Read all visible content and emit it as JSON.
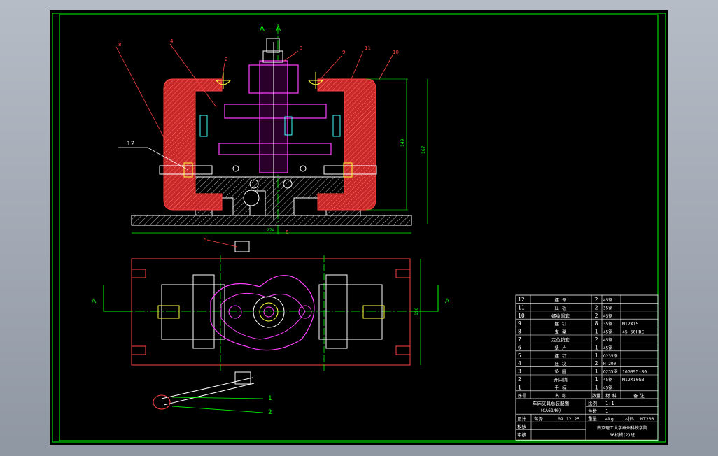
{
  "drawing": {
    "section_label": "A — A",
    "view_marker": "A",
    "part_callouts": [
      "8",
      "4",
      "2",
      "3",
      "9",
      "11",
      "10",
      "12",
      "6",
      "5",
      "1",
      "2"
    ],
    "dimensions": {
      "overall_width": "274",
      "height_inner": "149",
      "height_outer": "167",
      "plan_height": "196"
    }
  },
  "bom": {
    "rows": [
      {
        "no": "12",
        "name": "螺 母",
        "qty": "2",
        "material": "45钢",
        "note": ""
      },
      {
        "no": "11",
        "name": "压 板",
        "qty": "2",
        "material": "35钢",
        "note": ""
      },
      {
        "no": "10",
        "name": "螺纹滑套",
        "qty": "2",
        "material": "45钢",
        "note": ""
      },
      {
        "no": "9",
        "name": "螺 钉",
        "qty": "8",
        "material": "35钢",
        "note": "M12X15"
      },
      {
        "no": "8",
        "name": "支 架",
        "qty": "1",
        "material": "45钢",
        "note": "45~50HRC"
      },
      {
        "no": "7",
        "name": "定位销套",
        "qty": "2",
        "material": "45钢",
        "note": ""
      },
      {
        "no": "6",
        "name": "垫 片",
        "qty": "1",
        "material": "45钢",
        "note": ""
      },
      {
        "no": "5",
        "name": "螺 钉",
        "qty": "1",
        "material": "Q235钢",
        "note": ""
      },
      {
        "no": "4",
        "name": "压 块",
        "qty": "2",
        "material": "HT200",
        "note": ""
      },
      {
        "no": "3",
        "name": "垫 圈",
        "qty": "1",
        "material": "Q235钢",
        "note": "16GB95-80"
      },
      {
        "no": "2",
        "name": "开口销",
        "qty": "1",
        "material": "45钢",
        "note": "M12X10GB"
      },
      {
        "no": "1",
        "name": "手 柄",
        "qty": "1",
        "material": "45钢",
        "note": ""
      }
    ],
    "header": {
      "no": "序号",
      "name": "名 称",
      "qty": "数量",
      "material": "材 料",
      "note": "备 注"
    }
  },
  "title_block": {
    "title": "车床夹具总装配图",
    "subtitle": "（CA6140）",
    "scale_label": "比例",
    "scale_value": "1:1",
    "count_label": "件数",
    "count_value": "1",
    "designer_label": "设计",
    "designer": "蒋泽",
    "date": "09.12.25",
    "weight_label": "重量",
    "weight_value": "4kg",
    "material_label": "材料",
    "material_value": "HT200",
    "checker_label": "校核",
    "reviewer_label": "审核",
    "school": "南京理工大学泰州科技学院",
    "class_id": "06机械(2)班"
  },
  "colors": {
    "frame": "#00ff00",
    "body_red": "#ff3030",
    "magenta": "#ff40ff",
    "yellow": "#ffff40",
    "cyan": "#40ffff",
    "white": "#ffffff"
  }
}
